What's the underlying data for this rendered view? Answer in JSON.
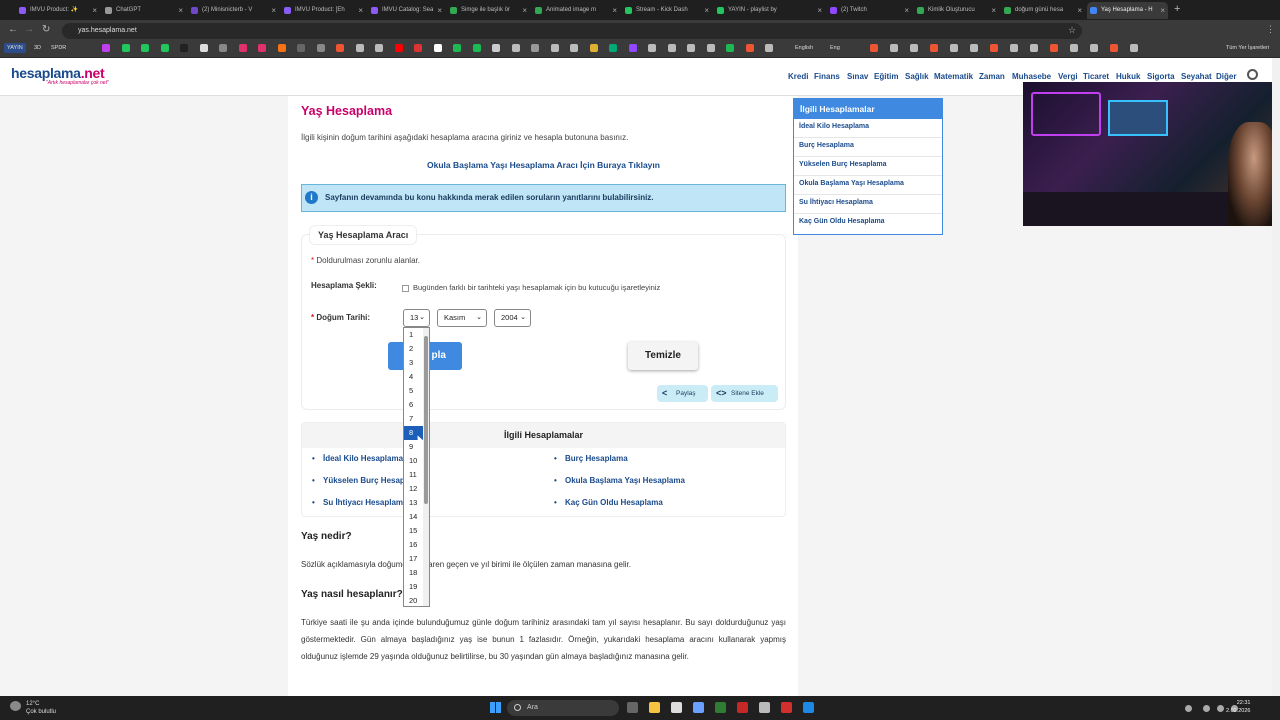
{
  "browser": {
    "tabs": [
      "IMVU Product: ✨",
      "ChatGPT",
      "(2) Minisnicterb - V",
      "IMVU Product: [Eh",
      "IMVU Catalog: Sea",
      "Simge ile başlık ör",
      "Animated image m",
      "Stream - Kick Dash",
      "YAYIN - playlist by",
      "(2) Twitch",
      "Kimlik Oluşturucu",
      "doğum günü hesa",
      "Yaş Hesaplama - H"
    ],
    "url": "yas.hesaplama.net",
    "bookmark_labels": [
      "YAYIN",
      "3D",
      "SPDR",
      "English",
      "Eng",
      "Tüm Yer İşaretleri"
    ]
  },
  "site": {
    "logo_main": "hesaplama",
    "logo_tld": ".net",
    "slogan": "\"Artık hesaplamalar çok net\"",
    "nav": [
      "Kredi",
      "Finans",
      "Sınav",
      "Eğitim",
      "Sağlık",
      "Matematik",
      "Zaman",
      "Muhasebe",
      "Vergi",
      "Ticaret",
      "Hukuk",
      "Sigorta",
      "Seyahat",
      "Diğer"
    ]
  },
  "main": {
    "title": "Yaş Hesaplama",
    "intro": "İlgili kişinin doğum tarihini aşağıdaki hesaplama aracına giriniz ve hesapla butonuna basınız.",
    "school_link": "Okula Başlama Yaşı Hesaplama Aracı İçin Buraya Tıklayın",
    "info": "Sayfanın devamında bu konu hakkında merak edilen soruların yanıtlarını bulabilirsiniz.",
    "tool_title": "Yaş Hesaplama Aracı",
    "required_note": "Doldurulması zorunlu alanlar.",
    "calc_type_label": "Hesaplama Şekli:",
    "calc_type_checkbox": "Bugünden farklı bir tarihteki yaşı hesaplamak için bu kutucuğu işaretleyiniz",
    "birth_label": "Doğum Tarihi:",
    "day_value": "13",
    "month_value": "Kasım",
    "year_value": "2004",
    "calc_button": "Hesapla",
    "calc_button_visible": "pla",
    "clear_button": "Temizle",
    "share": "Paylaş",
    "embed": "Sitene Ekle",
    "related_title": "İlgili Hesaplamalar",
    "related_left": [
      "İdeal Kilo Hesaplama",
      "Yükselen Burç Hesaplama",
      "Su İhtiyacı Hesaplama"
    ],
    "related_right": [
      "Burç Hesaplama",
      "Okula Başlama Yaşı Hesaplama",
      "Kaç Gün Oldu Hesaplama"
    ],
    "h_what": "Yaş nedir?",
    "p_what": "Sözlük açıklamasıyla doğumdan itibaren geçen ve yıl birimi ile ölçülen zaman manasına gelir.",
    "h_how": "Yaş nasıl hesaplanır?",
    "p_how": "Türkiye saati ile şu anda içinde bulunduğumuz günle doğum tarihiniz arasındaki tam yıl sayısı hesaplanır. Bu sayı doldurduğunuz yaşı göstermektedir. Gün almaya başladığınız yaş ise bunun 1 fazlasıdır. Örneğin, yukarıdaki hesaplama aracını kullanarak yapmış olduğunuz işlemde 29 yaşında olduğunuz belirtilirse, bu 30 yaşından gün almaya başladığınız manasına gelir."
  },
  "dropdown": {
    "options": [
      "1",
      "2",
      "3",
      "4",
      "5",
      "6",
      "7",
      "8",
      "9",
      "10",
      "11",
      "12",
      "13",
      "14",
      "15",
      "16",
      "17",
      "18",
      "19",
      "20"
    ],
    "highlighted": "8"
  },
  "sidebar": {
    "title": "İlgili Hesaplamalar",
    "items": [
      "İdeal Kilo Hesaplama",
      "Burç Hesaplama",
      "Yükselen Burç Hesaplama",
      "Okula Başlama Yaşı Hesaplama",
      "Su İhtiyacı Hesaplama",
      "Kaç Gün Oldu Hesaplama"
    ]
  },
  "taskbar": {
    "temp": "12°C",
    "weather": "Çok bulutlu",
    "search": "Ara",
    "time": "22:31",
    "date": "2.02.2026"
  },
  "colors": {
    "brand_blue": "#1a4b8c",
    "brand_pink": "#c8006a",
    "accent": "#3f8ae0",
    "info_bg": "#bfe5f7"
  }
}
